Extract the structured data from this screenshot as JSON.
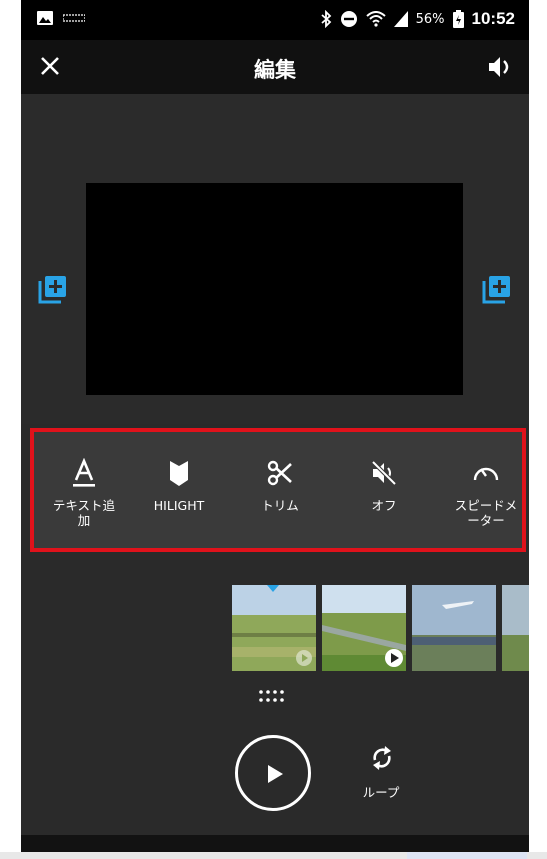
{
  "status_bar": {
    "battery_percent": "56%",
    "time": "10:52"
  },
  "app_bar": {
    "title": "編集"
  },
  "toolbar": {
    "items": [
      {
        "label": "テキスト追\n加",
        "icon": "text-a-icon"
      },
      {
        "label": "HILIGHT",
        "icon": "hilight-tag-icon"
      },
      {
        "label": "トリム",
        "icon": "scissors-icon"
      },
      {
        "label": "オフ",
        "icon": "mute-speaker-icon"
      },
      {
        "label": "スピードメ\nーター",
        "icon": "speedometer-icon"
      }
    ]
  },
  "playback": {
    "loop_label": "ループ"
  },
  "colors": {
    "accent": "#29a3e6",
    "highlight_border": "#e0121b"
  }
}
